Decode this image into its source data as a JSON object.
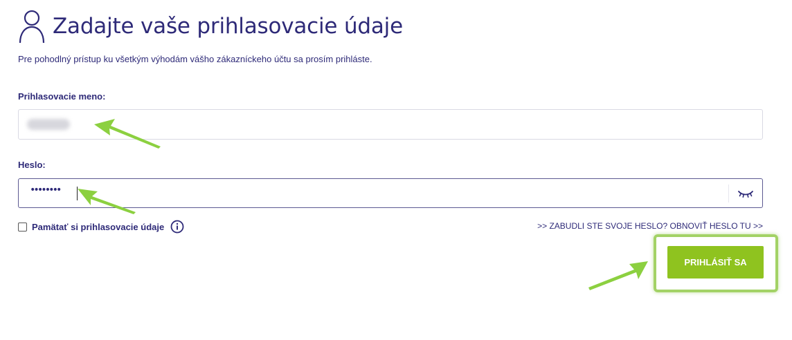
{
  "header": {
    "title": "Zadajte vaše prihlasovacie údaje",
    "subtitle": "Pre pohodlný prístup ku všetkým výhodám vášho zákazníckeho účtu sa prosím prihláste.",
    "icon": "user-icon"
  },
  "form": {
    "username_label": "Prihlasovacie meno:",
    "username_value": "",
    "password_label": "Heslo:",
    "password_value": "••••••••",
    "show_password_icon": "eye-closed-icon",
    "remember_label": "Pamätať si prihlasovacie údaje",
    "remember_checked": false,
    "info_icon": "info-icon",
    "forgot_link": ">> ZABUDLI STE SVOJE HESLO? OBNOVIŤ HESLO TU >>",
    "submit_label": "PRIHLÁSIŤ SA"
  },
  "colors": {
    "primary_text": "#2e2a78",
    "button": "#8fc31f",
    "highlight": "#a3d266",
    "annotation_arrow": "#8cd040"
  },
  "annotations": {
    "arrows": [
      "arrow-to-username",
      "arrow-to-password",
      "arrow-to-login-button"
    ]
  }
}
